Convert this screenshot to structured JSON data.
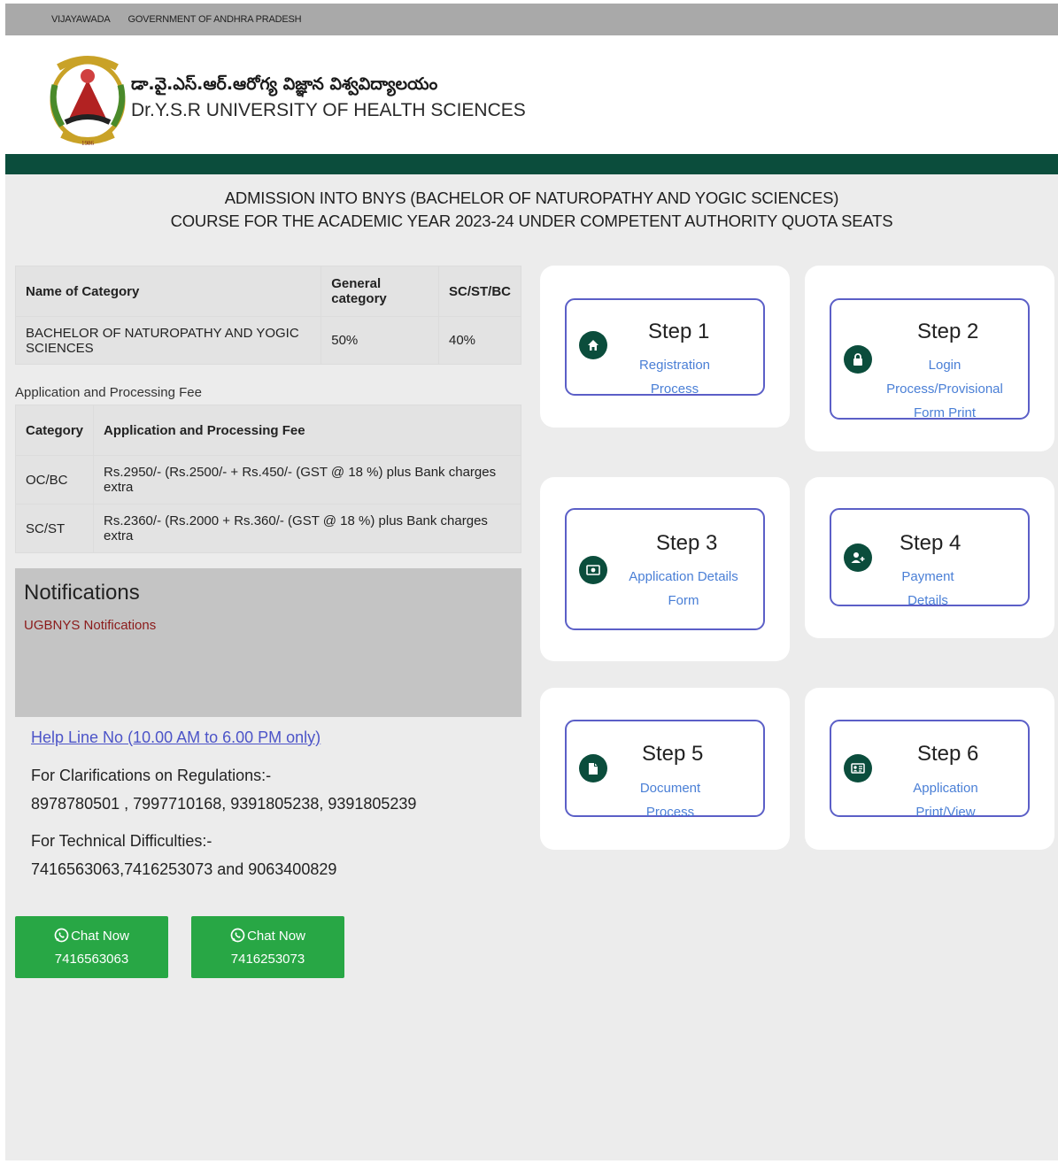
{
  "topbar": {
    "city": "VIJAYAWADA",
    "gov": "GOVERNMENT OF ANDHRA PRADESH"
  },
  "header": {
    "title_telugu": "డా.వై.ఎస్.ఆర్.ఆరోగ్య విజ్ఞాన విశ్వవిద్యాలయం",
    "title_english": "Dr.Y.S.R UNIVERSITY OF HEALTH SCIENCES",
    "logo_year": "1986"
  },
  "admission": {
    "line1": "ADMISSION INTO BNYS (BACHELOR OF NATUROPATHY AND YOGIC SCIENCES)",
    "line2": "COURSE FOR THE ACADEMIC YEAR 2023-24 UNDER COMPETENT AUTHORITY QUOTA SEATS"
  },
  "category_table": {
    "headers": [
      "Name of Category",
      "General category",
      "SC/ST/BC"
    ],
    "rows": [
      [
        "BACHELOR OF NATUROPATHY AND YOGIC SCIENCES",
        "50%",
        "40%"
      ]
    ]
  },
  "fee": {
    "label": "Application and Processing Fee",
    "headers": [
      "Category",
      "Application and Processing Fee"
    ],
    "rows": [
      [
        "OC/BC",
        "Rs.2950/- (Rs.2500/- + Rs.450/- (GST @ 18 %) plus Bank charges extra"
      ],
      [
        "SC/ST",
        "Rs.2360/- (Rs.2000 + Rs.360/- (GST @ 18 %) plus Bank charges extra"
      ]
    ]
  },
  "notifications": {
    "title": "Notifications",
    "link": "UGBNYS Notifications"
  },
  "help": {
    "link": "Help Line No (10.00 AM to 6.00 PM only)",
    "clar_label": "For Clarifications on Regulations:-",
    "clar_numbers": "8978780501 , 7997710168, 9391805238, 9391805239",
    "tech_label": "For Technical Difficulties:-",
    "tech_numbers": "7416563063,7416253073 and 9063400829"
  },
  "chat": [
    {
      "label": "Chat Now",
      "number": "7416563063"
    },
    {
      "label": "Chat Now",
      "number": "7416253073"
    }
  ],
  "steps": [
    {
      "title": "Step 1",
      "line1": "Registration Process",
      "line2": "",
      "icon": "home-icon"
    },
    {
      "title": "Step 2",
      "line1": "Login Process/Provisional",
      "line2": "Form Print",
      "icon": "lock-icon"
    },
    {
      "title": "Step 3",
      "line1": "Application Details",
      "line2": "Form",
      "icon": "money-icon"
    },
    {
      "title": "Step 4",
      "line1": "Payment Details",
      "line2": "",
      "icon": "user-plus-icon"
    },
    {
      "title": "Step 5",
      "line1": "Document Process",
      "line2": "",
      "icon": "file-icon"
    },
    {
      "title": "Step 6",
      "line1": "Application Print/View",
      "line2": "",
      "icon": "id-card-icon"
    }
  ],
  "colors": {
    "dark_green": "#0b4d3c",
    "chat_green": "#28a745",
    "step_border": "#5b5fc7",
    "link_blue": "#4a7fd6"
  }
}
